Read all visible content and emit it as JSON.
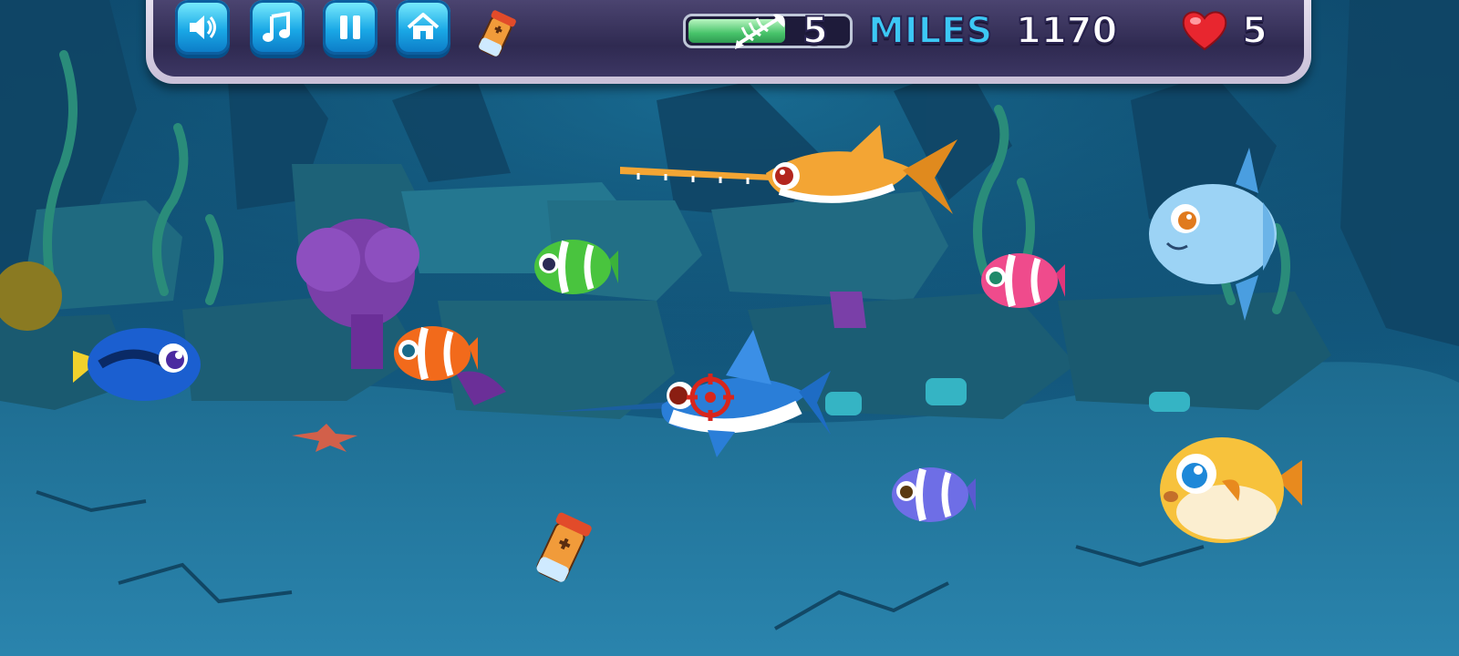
{
  "hud": {
    "buttons": [
      {
        "name": "sound-button",
        "icon": "speaker-icon"
      },
      {
        "name": "music-button",
        "icon": "music-note-icon"
      },
      {
        "name": "pause-button",
        "icon": "pause-icon"
      },
      {
        "name": "home-button",
        "icon": "home-icon"
      }
    ],
    "powerup_icon": "potion-bottle-icon",
    "meter": {
      "level_percent": 62
    },
    "fish_eaten": "5",
    "miles_label": "MILES",
    "miles_value": "1170",
    "lives": "5"
  },
  "colors": {
    "water_top": "#0d4a6e",
    "water_bottom": "#1e6e96",
    "hud_frame": "#e9e3f1",
    "hud_panel": "#3a3460",
    "button": "#1aa8e6",
    "miles_text": "#3cc8f5",
    "heart": "#e8262f",
    "meter_fill": "#47c36a"
  },
  "scene": {
    "player": "swordfish",
    "target_marker": "crosshair-icon",
    "fish": [
      "blue-tang",
      "clownfish-orange",
      "clownfish-green",
      "clownfish-pink",
      "clownfish-purple",
      "sawfish",
      "sunfish",
      "pufferfish"
    ],
    "pickups": [
      "potion-bottle"
    ],
    "decor": [
      "starfish",
      "purple-coral",
      "seaweed",
      "rocks"
    ]
  }
}
